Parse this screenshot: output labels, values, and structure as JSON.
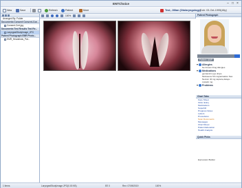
{
  "app": {
    "title": "ENTChoice"
  },
  "toolbar": {
    "new_label": "New",
    "save_label": "Save",
    "refresh_label": "Refresh",
    "patient_label": "Patient",
    "more_label": "More"
  },
  "patient_header": {
    "name": "Test, Jillian (Otolaryngology)",
    "dob": "Dob: 03-Oct-1995(48y)",
    "chart_label": "Select Chart"
  },
  "left_panel": {
    "sort_label": "Arranged By: Folder",
    "groups": [
      {
        "label": "Documents:Consent:Consent-Con...",
        "items": [
          {
            "label": "Consent-Cert.jpg",
            "selected": false
          }
        ]
      },
      {
        "label": "Documents:Test Results:Test Re...",
        "items": [
          {
            "label": "LaryngealStudyImage_JPG",
            "selected": true
          }
        ]
      },
      {
        "label": "Patient Photograph:EMR Photo...",
        "items": [
          {
            "label": "EMR_Headshots_Pat...",
            "selected": false
          }
        ]
      }
    ]
  },
  "viewer": {
    "zoom_label": "100%"
  },
  "right_panel": {
    "photo_header": "Patient Photograph",
    "photo_caption": "Patient: AMP",
    "allergies": {
      "label": "Allergies",
      "rows": [
        "No Known Drug Allergies"
      ]
    },
    "medications": {
      "label": "Medications",
      "rows": [
        "gentamicin eye drops",
        "fluticasone 50 mcg/actuation Nas",
        "Nexium 40 mg capsule,delaye...",
        "cystatin mg"
      ]
    },
    "problems": {
      "label": "Problems"
    },
    "chart_tabs": {
      "header": "Chart Tabs",
      "items": [
        {
          "label": "Face Sheet",
          "active": false
        },
        {
          "label": "Order Entry",
          "active": false
        },
        {
          "label": "Medications",
          "active": false
        },
        {
          "label": "Superbill",
          "active": false
        },
        {
          "label": "Progress Notes",
          "active": false
        },
        {
          "label": "Letters",
          "active": false
        },
        {
          "label": "Procedures",
          "active": false
        },
        {
          "label": "Scan Documents",
          "active": true
        },
        {
          "label": "Messages",
          "active": false
        },
        {
          "label": "Chart Sheet",
          "active": false
        },
        {
          "label": "Patient Education",
          "active": false
        },
        {
          "label": "Health Analysis",
          "active": false
        }
      ]
    },
    "quick_picks_header": "Quick Picks",
    "expression_label": "Expression Builder"
  },
  "statusbar": {
    "left": "1 Items",
    "file": "LaryngealStudyImage.JPG(0.00 KB)",
    "zoom": "EE 0",
    "date": "Rev: 07/09/2019",
    "right": "100%"
  },
  "colors": {
    "accent": "#1f49a6",
    "active_tab": "#d47a10",
    "header_bg": "#dfe7f2"
  }
}
